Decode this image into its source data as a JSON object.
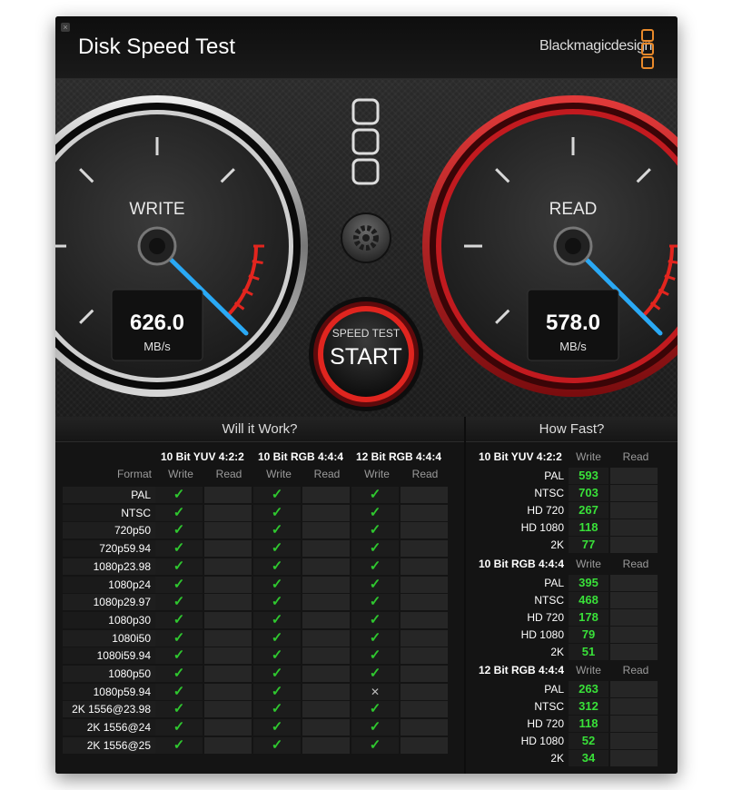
{
  "app": {
    "title": "Disk Speed Test",
    "brand": "Blackmagicdesign",
    "close_glyph": "×"
  },
  "gauges": {
    "write": {
      "label": "WRITE",
      "value": "626.0",
      "unit": "MB/s"
    },
    "read": {
      "label": "READ",
      "value": "578.0",
      "unit": "MB/s"
    }
  },
  "start_button": {
    "caption": "SPEED TEST",
    "label": "START"
  },
  "will_it_work": {
    "title": "Will it Work?",
    "format_label": "Format",
    "groups": [
      "10 Bit YUV 4:2:2",
      "10 Bit RGB 4:4:4",
      "12 Bit RGB 4:4:4"
    ],
    "write_label": "Write",
    "read_label": "Read",
    "rows": [
      {
        "format": "PAL",
        "w": [
          "✓",
          "✓",
          "✓"
        ]
      },
      {
        "format": "NTSC",
        "w": [
          "✓",
          "✓",
          "✓"
        ]
      },
      {
        "format": "720p50",
        "w": [
          "✓",
          "✓",
          "✓"
        ]
      },
      {
        "format": "720p59.94",
        "w": [
          "✓",
          "✓",
          "✓"
        ]
      },
      {
        "format": "1080p23.98",
        "w": [
          "✓",
          "✓",
          "✓"
        ]
      },
      {
        "format": "1080p24",
        "w": [
          "✓",
          "✓",
          "✓"
        ]
      },
      {
        "format": "1080p29.97",
        "w": [
          "✓",
          "✓",
          "✓"
        ]
      },
      {
        "format": "1080p30",
        "w": [
          "✓",
          "✓",
          "✓"
        ]
      },
      {
        "format": "1080i50",
        "w": [
          "✓",
          "✓",
          "✓"
        ]
      },
      {
        "format": "1080i59.94",
        "w": [
          "✓",
          "✓",
          "✓"
        ]
      },
      {
        "format": "1080p50",
        "w": [
          "✓",
          "✓",
          "✓"
        ]
      },
      {
        "format": "1080p59.94",
        "w": [
          "✓",
          "✓",
          "✕"
        ]
      },
      {
        "format": "2K 1556@23.98",
        "w": [
          "✓",
          "✓",
          "✓"
        ]
      },
      {
        "format": "2K 1556@24",
        "w": [
          "✓",
          "✓",
          "✓"
        ]
      },
      {
        "format": "2K 1556@25",
        "w": [
          "✓",
          "✓",
          "✓"
        ]
      }
    ]
  },
  "how_fast": {
    "title": "How Fast?",
    "write_label": "Write",
    "read_label": "Read",
    "groups": [
      {
        "name": "10 Bit YUV 4:2:2",
        "rows": [
          {
            "label": "PAL",
            "write": "593"
          },
          {
            "label": "NTSC",
            "write": "703"
          },
          {
            "label": "HD 720",
            "write": "267"
          },
          {
            "label": "HD 1080",
            "write": "118"
          },
          {
            "label": "2K",
            "write": "77"
          }
        ]
      },
      {
        "name": "10 Bit RGB 4:4:4",
        "rows": [
          {
            "label": "PAL",
            "write": "395"
          },
          {
            "label": "NTSC",
            "write": "468"
          },
          {
            "label": "HD 720",
            "write": "178"
          },
          {
            "label": "HD 1080",
            "write": "79"
          },
          {
            "label": "2K",
            "write": "51"
          }
        ]
      },
      {
        "name": "12 Bit RGB 4:4:4",
        "rows": [
          {
            "label": "PAL",
            "write": "263"
          },
          {
            "label": "NTSC",
            "write": "312"
          },
          {
            "label": "HD 720",
            "write": "118"
          },
          {
            "label": "HD 1080",
            "write": "52"
          },
          {
            "label": "2K",
            "write": "34"
          }
        ]
      }
    ]
  },
  "colors": {
    "accent_green": "#39e039",
    "needle": "#2aa9f5",
    "read_ring": "#b3161b",
    "brand_orange": "#e8892a"
  }
}
